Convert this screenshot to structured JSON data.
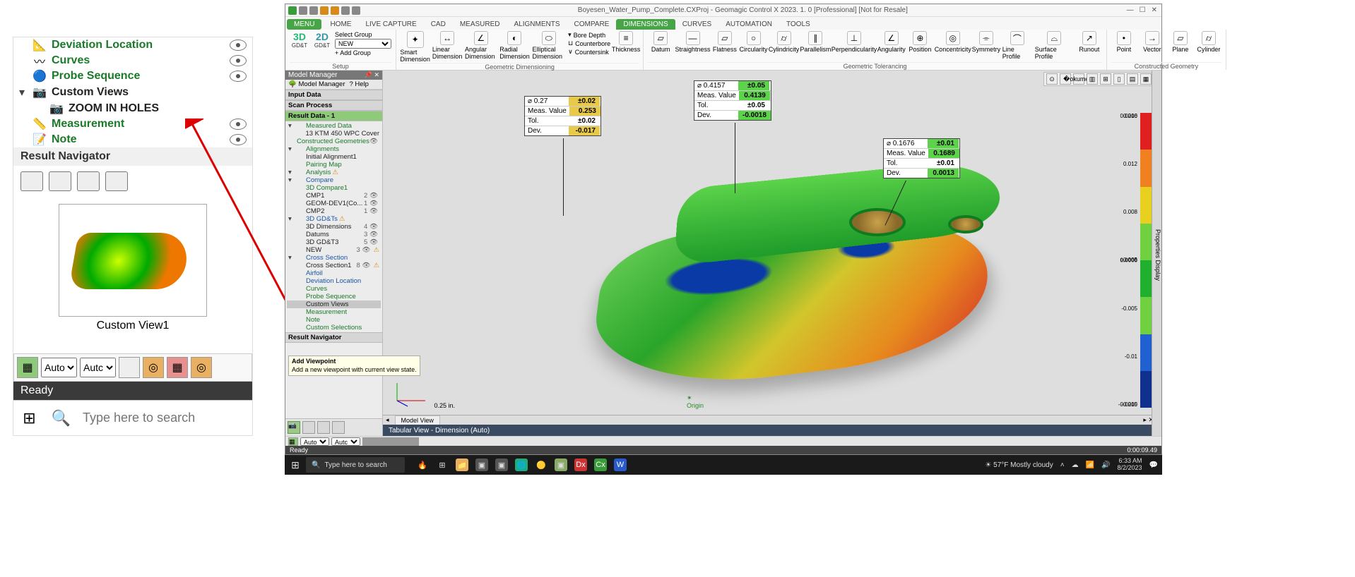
{
  "left_panel": {
    "items": [
      {
        "label": "Deviation Location",
        "color": "green",
        "eye": true
      },
      {
        "label": "Curves",
        "color": "green",
        "eye": true
      },
      {
        "label": "Probe Sequence",
        "color": "green",
        "eye": true
      },
      {
        "label": "Custom Views",
        "color": "black",
        "chev": "▾"
      },
      {
        "label": "ZOOM IN HOLES",
        "color": "black",
        "sub": true
      },
      {
        "label": "Measurement",
        "color": "green",
        "eye": true
      },
      {
        "label": "Note",
        "color": "green",
        "eye": true
      }
    ],
    "result_nav": "Result Navigator",
    "custom_view_caption": "Custom View1",
    "auto1": "Auto",
    "auto2": "Autc",
    "ready": "Ready",
    "search_placeholder": "Type here to search"
  },
  "app": {
    "title": "Boyesen_Water_Pump_Complete.CXProj - Geomagic Control X 2023. 1. 0 [Professional] [Not for Resale]",
    "menus": [
      "MENU",
      "HOME",
      "LIVE CAPTURE",
      "CAD",
      "MEASURED",
      "ALIGNMENTS",
      "COMPARE",
      "DIMENSIONS",
      "CURVES",
      "AUTOMATION",
      "TOOLS"
    ],
    "active_menu": "DIMENSIONS",
    "ribbon": {
      "setup": {
        "label": "Setup",
        "gd3": "3D",
        "gd2": "2D",
        "gdl": "GD&T",
        "select_group": "Select Group",
        "new": "NEW",
        "add": "+ Add Group"
      },
      "geom_dim": {
        "label": "Geometric Dimensioning",
        "btns": [
          "Smart Dimension",
          "Linear Dimension",
          "Angular Dimension",
          "Radial Dimension",
          "Elliptical Dimension"
        ],
        "opts": [
          "Bore Depth",
          "Counterbore",
          "Countersink"
        ],
        "thick": "Thickness"
      },
      "geom_tol": {
        "label": "Geometric Tolerancing",
        "btns": [
          "Datum",
          "Straightness",
          "Flatness",
          "Circularity",
          "Cylindricity",
          "Parallelism",
          "Perpendicularity",
          "Angularity",
          "Position",
          "Concentricity",
          "Symmetry",
          "Line Profile",
          "Surface Profile",
          "Runout"
        ]
      },
      "cons_geo": {
        "label": "Constructed Geometry",
        "btns": [
          "Point",
          "Vector",
          "Plane",
          "Cylinder"
        ]
      }
    },
    "mm": {
      "title": "Model Manager",
      "tabs": [
        "Model Manager",
        "Help"
      ],
      "sections": {
        "input": "Input Data",
        "scan": "Scan Process",
        "result": "Result Data - 1",
        "resnav": "Result Navigator"
      },
      "tree": [
        {
          "l": 1,
          "t": "Measured Data",
          "chv": "▾",
          "c": "g"
        },
        {
          "l": 2,
          "t": "13 KTM 450 WPC Cover"
        },
        {
          "l": 1,
          "t": "Constructed Geometries",
          "c": "g",
          "cnt": ""
        },
        {
          "l": 1,
          "t": "Alignments",
          "chv": "▾",
          "c": "g"
        },
        {
          "l": 2,
          "t": "Initial Alignment1"
        },
        {
          "l": 1,
          "t": "Pairing Map",
          "c": "g"
        },
        {
          "l": 1,
          "t": "Analysis",
          "chv": "▾",
          "c": "g",
          "warn": "⚠"
        },
        {
          "l": 2,
          "t": "Compare",
          "chv": "▾",
          "c": "b"
        },
        {
          "l": 3,
          "t": "3D Compare1",
          "c": "g"
        },
        {
          "l": 4,
          "t": "CMP1",
          "cnt": "2"
        },
        {
          "l": 4,
          "t": "GEOM-DEV1(Co...",
          "cnt": "1"
        },
        {
          "l": 4,
          "t": "CMP2",
          "cnt": "1"
        },
        {
          "l": 2,
          "t": "3D GD&Ts",
          "chv": "▾",
          "c": "b",
          "warn": "⚠"
        },
        {
          "l": 3,
          "t": "3D Dimensions",
          "cnt": "4"
        },
        {
          "l": 3,
          "t": "Datums",
          "cnt": "3"
        },
        {
          "l": 3,
          "t": "3D GD&T3",
          "cnt": "5"
        },
        {
          "l": 3,
          "t": "NEW",
          "cnt": "3",
          "warn": "⚠"
        },
        {
          "l": 2,
          "t": "Cross Section",
          "chv": "▾",
          "c": "b"
        },
        {
          "l": 3,
          "t": "Cross Section1",
          "cnt": "8",
          "warn": "⚠"
        },
        {
          "l": 2,
          "t": "Airfoil",
          "c": "b"
        },
        {
          "l": 2,
          "t": "Deviation Location",
          "c": "b"
        },
        {
          "l": 1,
          "t": "Curves",
          "c": "g"
        },
        {
          "l": 1,
          "t": "Probe Sequence",
          "c": "g"
        },
        {
          "l": 1,
          "t": "Custom Views",
          "sel": true
        },
        {
          "l": 1,
          "t": "Measurement",
          "c": "g"
        },
        {
          "l": 1,
          "t": "Note",
          "c": "g"
        },
        {
          "l": 1,
          "t": "Custom Selections",
          "c": "g"
        }
      ],
      "tooltip_title": "Add Viewpoint",
      "tooltip_body": "Add a new viewpoint with current view state."
    },
    "callouts": [
      {
        "pos": "co1",
        "rows": [
          [
            "⌀ 0.27",
            "±0.02",
            "y"
          ],
          [
            "Meas. Value",
            "0.253",
            "y"
          ],
          [
            "Tol.",
            "±0.02",
            "w"
          ],
          [
            "Dev.",
            "-0.017",
            "y"
          ]
        ]
      },
      {
        "pos": "co2",
        "rows": [
          [
            "⌀ 0.4157",
            "±0.05",
            "g"
          ],
          [
            "Meas. Value",
            "0.4139",
            "g"
          ],
          [
            "Tol.",
            "±0.05",
            "w"
          ],
          [
            "Dev.",
            "-0.0018",
            "g"
          ]
        ]
      },
      {
        "pos": "co3",
        "rows": [
          [
            "⌀ 0.1676",
            "±0.01",
            "g"
          ],
          [
            "Meas. Value",
            "0.1689",
            "g"
          ],
          [
            "Tol.",
            "±0.01",
            "w"
          ],
          [
            "Dev.",
            "0.0013",
            "g"
          ]
        ]
      }
    ],
    "colorbar": {
      "top": "0.0200",
      "labels": [
        "0.016",
        "0.012",
        "0.008",
        "0.005",
        "-0.005",
        "-0.01",
        "-0.015"
      ],
      "zero": "0.0000",
      "bottom": "-0.0200"
    },
    "axis_scale": "0.25 in.",
    "origin": "Origin",
    "model_view_tab": "Model View",
    "tabular": "Tabular View - Dimension (Auto)",
    "prop": "Properties  Display",
    "status": {
      "auto1": "Auto",
      "auto2": "Autc"
    },
    "ready": "Ready",
    "elapsed": "0:00:09.49"
  },
  "taskbar2": {
    "search": "Type here to search",
    "weather": "57°F  Mostly cloudy",
    "time": "6:33 AM",
    "date": "8/2/2023"
  }
}
